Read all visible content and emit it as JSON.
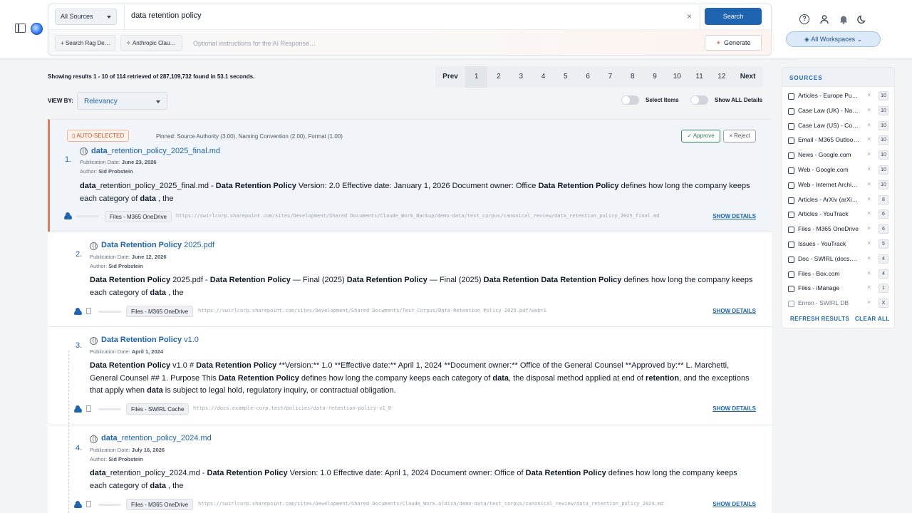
{
  "search": {
    "source_select": "All Sources",
    "query": "data retention policy",
    "clear": "×",
    "button": "Search",
    "chips": [
      "Search Rag De…",
      "Anthropic Clau…"
    ],
    "chip_icons": [
      "plus-icon",
      "sparkle-icon"
    ],
    "ai_placeholder": "Optional instructions for the AI Response…",
    "generate": "Generate"
  },
  "header": {
    "workspaces": "All Workspaces",
    "icons": [
      "help-icon",
      "user-icon",
      "bell-icon",
      "moon-icon"
    ]
  },
  "results_header": {
    "summary": "Showing results 1 - 10 of 114 retrieved of 287,109,732 found in 53.1 seconds.",
    "view_by_label": "VIEW BY:",
    "view_by_value": "Relevancy",
    "select_items": "Select Items",
    "show_all": "Show ALL Details"
  },
  "pagination": {
    "prev": "Prev",
    "pages": [
      "1",
      "2",
      "3",
      "4",
      "5",
      "6",
      "7",
      "8",
      "9",
      "10",
      "11",
      "12"
    ],
    "current": "1",
    "next": "Next"
  },
  "pinned": {
    "badge": "AUTO-SELECTED",
    "text": "Pinned: Source Authority (3.00), Naming Convention (2.00), Format (1.00)",
    "approve": "Approve",
    "reject": "Reject"
  },
  "show_details_label": "SHOW DETAILS",
  "results": [
    {
      "num": "1.",
      "title_bold": "data",
      "title_rest": "_retention_policy_2025_final.md",
      "date": "June 23, 2026",
      "author": "Sid Probstein",
      "snippet_html": "<b>data</b>_retention_policy_2025_final.md - <b>Data Retention Policy</b> Version: 2.0 Effective date: January 1, 2026 Document owner: Office <b>Data Retention Policy</b> defines how long the company keeps each category of <b>data</b> , the",
      "source": "Files - M365 OneDrive",
      "url": "https://swirlcorp.sharepoint.com/sites/Development/Shared Documents/Claude_Work_Backup/demo-data/test_corpus/canonical_review/data_retention_policy_2025_final.md"
    },
    {
      "num": "2.",
      "title_bold": "Data Retention Policy",
      "title_rest": " 2025.pdf",
      "date": "June 12, 2026",
      "author": "Sid Probstein",
      "snippet_html": "<b>Data Retention Policy</b> 2025.pdf - <b>Data Retention Policy</b> — Final (2025) <b>Data Retention Policy</b> — Final (2025) <b>Data Retention Data Retention Policy</b> defines how long the company keeps each category of <b>data</b> , the",
      "source": "Files - M365 OneDrive",
      "url": "https://swirlcorp.sharepoint.com/sites/Development/Shared Documents/Test_Corpus/Data Retention Policy 2025.pdf?web=1"
    },
    {
      "num": "3.",
      "title_bold": "Data Retention Policy",
      "title_rest": " v1.0",
      "date": "April 1, 2024",
      "author": "",
      "snippet_html": "<b>Data Retention Policy</b> v1.0 # <b>Data Retention Policy</b> **Version:** 1.0 **Effective date:** April 1, 2024 **Document owner:** Office of the General Counsel **Approved by:** L. Marchetti, General Counsel ## 1. Purpose This <b>Data Retention Policy</b> defines how long the company keeps each category of <b>data</b>, the disposal method applied at end of <b>retention</b>, and the exceptions that apply when <b>data</b> is subject to legal hold, regulatory inquiry, or contractual obligation.",
      "source": "Files - SWIRL Cache",
      "url": "https://docs.example-corp.test/policies/data-retention-policy-v1_0"
    },
    {
      "num": "4.",
      "title_bold": "data",
      "title_rest": "_retention_policy_2024.md",
      "date": "July 16, 2026",
      "author": "Sid Probstein",
      "snippet_html": "<b>data</b>_retention_policy_2024.md - <b>Data Retention Policy</b> Version: 1.0 Effective date: April 1, 2024 Document owner: Office of <b>Data Retention Policy</b> defines how long the company keeps each category of <b>data</b> , the",
      "source": "Files - M365 OneDrive",
      "url": "https://swirlcorp.sharepoint.com/sites/Development/Shared Documents/Claude_Work.oldish/demo-data/test_corpus/canonical_review/data_retention_policy_2024.md"
    }
  ],
  "labels": {
    "pub_date": "Publication Date:",
    "author": "Author:"
  },
  "sources_panel": {
    "title": "SOURCES",
    "items": [
      {
        "name": "Articles - Europe Pu…",
        "count": "10"
      },
      {
        "name": "Case Law (UK) - Nat…",
        "count": "10"
      },
      {
        "name": "Case Law (US) - Cou…",
        "count": "10"
      },
      {
        "name": "Email - M365 Outloo…",
        "count": "10"
      },
      {
        "name": "News - Google.com",
        "count": "10"
      },
      {
        "name": "Web - Google.com",
        "count": "10"
      },
      {
        "name": "Web - Internet Archi…",
        "count": "10"
      },
      {
        "name": "Articles - ArXiv (arXi…",
        "count": "8"
      },
      {
        "name": "Articles - YouTrack",
        "count": "6"
      },
      {
        "name": "Files - M365 OneDrive",
        "count": "6"
      },
      {
        "name": "Issues - YouTrack",
        "count": "5"
      },
      {
        "name": "Doc - SWIRL (docs.s…",
        "count": "4"
      },
      {
        "name": "Files - Box.com",
        "count": "4"
      },
      {
        "name": "Files - iManage",
        "count": "1"
      },
      {
        "name": "Enron - SWIRL DB",
        "count": "X"
      }
    ],
    "refresh": "REFRESH RESULTS",
    "clear": "CLEAR ALL"
  }
}
